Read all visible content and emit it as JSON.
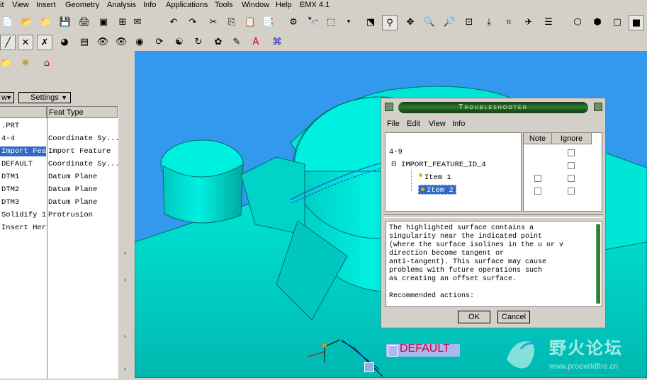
{
  "menu": [
    "it",
    "View",
    "Insert",
    "Geometry",
    "Analysis",
    "Info",
    "Applications",
    "Tools",
    "Window",
    "Help",
    "EMX 4.1"
  ],
  "left_panel": {
    "dropdown1": "w",
    "settings": "Settings",
    "col_feat_type": "Feat Type",
    "names": [
      ".PRT",
      "4-4",
      "Import Fea",
      "DEFAULT",
      "DTM1",
      "DTM2",
      "DTM3",
      "Solidify 1",
      "Insert Her"
    ],
    "types": [
      "",
      "Coordinate Sy...",
      "Import Feature",
      "Coordinate Sy...",
      "Datum Plane",
      "Datum Plane",
      "Datum Plane",
      "Protrusion",
      ""
    ]
  },
  "viewport": {
    "label": "DEFAULT",
    "bg_color": "#3399ee",
    "model_color": "#00e0d0"
  },
  "dialog": {
    "title": "Troubleshooter",
    "menu": [
      "File",
      "Edit",
      "View",
      "Info"
    ],
    "col_note": "Note",
    "col_ignore": "Ignore",
    "tree": [
      "4-9",
      "IMPORT_FEATURE_ID_4",
      "Item 1",
      "Item 2"
    ],
    "message": [
      "The highlighted surface contains a",
      "singularity near the indicated point",
      "(where the surface isolines in the u or v",
      "direction become tangent or",
      "anti-tangent). This surface may cause",
      "problems with future operations such",
      "as creating an offset surface.",
      "",
      "Recommended actions:"
    ],
    "ok": "OK",
    "cancel": "Cancel"
  },
  "watermark": {
    "text": "野火论坛",
    "url": "www.proewildfire.cn"
  }
}
